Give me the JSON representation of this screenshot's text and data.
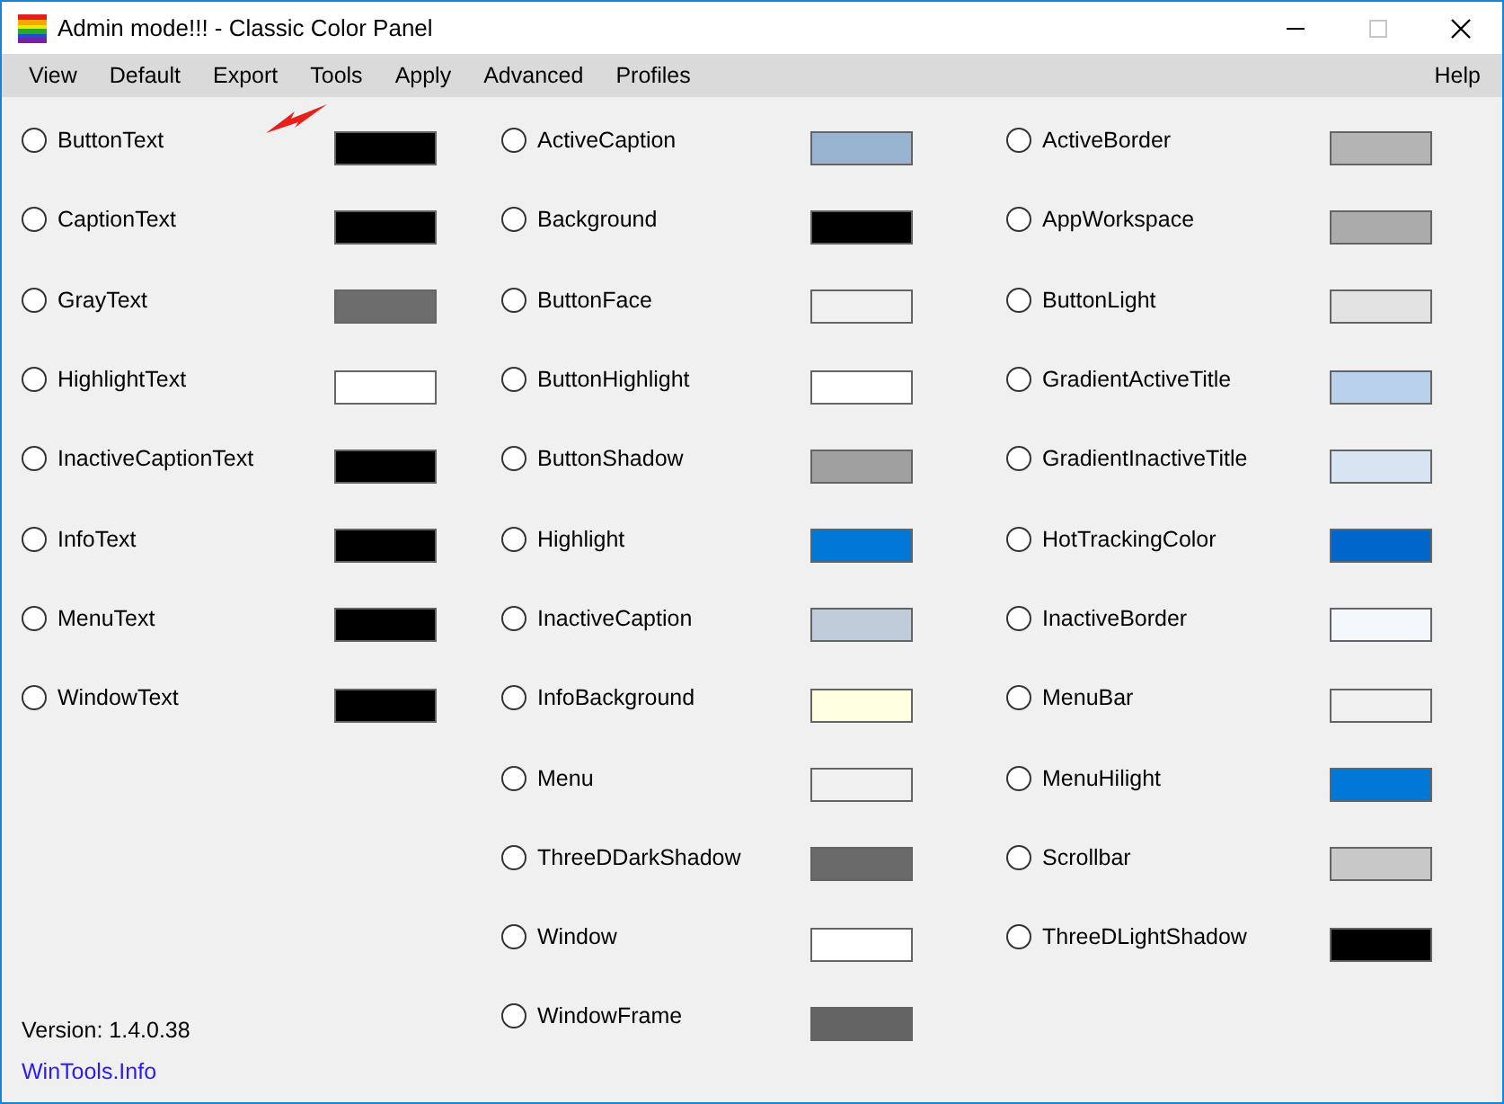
{
  "window": {
    "title": "Admin mode!!! - Classic Color Panel"
  },
  "menu": [
    {
      "label": "View"
    },
    {
      "label": "Default"
    },
    {
      "label": "Export"
    },
    {
      "label": "Tools"
    },
    {
      "label": "Apply"
    },
    {
      "label": "Advanced"
    },
    {
      "label": "Profiles"
    }
  ],
  "help_menu": {
    "label": "Help"
  },
  "columns": [
    [
      {
        "name": "ButtonText",
        "color": "#000000",
        "selected": false
      },
      {
        "name": "CaptionText",
        "color": "#000000",
        "selected": false
      },
      {
        "name": "GrayText",
        "color": "#6d6d6d",
        "selected": false
      },
      {
        "name": "HighlightText",
        "color": "#ffffff",
        "selected": false
      },
      {
        "name": "InactiveCaptionText",
        "color": "#000000",
        "selected": false
      },
      {
        "name": "InfoText",
        "color": "#000000",
        "selected": false
      },
      {
        "name": "MenuText",
        "color": "#000000",
        "selected": false
      },
      {
        "name": "WindowText",
        "color": "#000000",
        "selected": false
      }
    ],
    [
      {
        "name": "ActiveCaption",
        "color": "#99b4d1",
        "selected": false
      },
      {
        "name": "Background",
        "color": "#000000",
        "selected": false
      },
      {
        "name": "ButtonFace",
        "color": "#f0f0f0",
        "selected": false
      },
      {
        "name": "ButtonHighlight",
        "color": "#ffffff",
        "selected": false
      },
      {
        "name": "ButtonShadow",
        "color": "#a0a0a0",
        "selected": false
      },
      {
        "name": "Highlight",
        "color": "#0078d7",
        "selected": false
      },
      {
        "name": "InactiveCaption",
        "color": "#bfcddb",
        "selected": false
      },
      {
        "name": "InfoBackground",
        "color": "#ffffe1",
        "selected": false
      },
      {
        "name": "Menu",
        "color": "#f0f0f0",
        "selected": false
      },
      {
        "name": "ThreeDDarkShadow",
        "color": "#696969",
        "selected": false
      },
      {
        "name": "Window",
        "color": "#ffffff",
        "selected": false
      },
      {
        "name": "WindowFrame",
        "color": "#646464",
        "selected": false
      }
    ],
    [
      {
        "name": "ActiveBorder",
        "color": "#b4b4b4",
        "selected": false
      },
      {
        "name": "AppWorkspace",
        "color": "#ababab",
        "selected": false
      },
      {
        "name": "ButtonLight",
        "color": "#e3e3e3",
        "selected": false
      },
      {
        "name": "GradientActiveTitle",
        "color": "#b9d1ea",
        "selected": false
      },
      {
        "name": "GradientInactiveTitle",
        "color": "#d7e4f2",
        "selected": false
      },
      {
        "name": "HotTrackingColor",
        "color": "#0066cc",
        "selected": false
      },
      {
        "name": "InactiveBorder",
        "color": "#f4f7fc",
        "selected": false
      },
      {
        "name": "MenuBar",
        "color": "#f0f0f0",
        "selected": false
      },
      {
        "name": "MenuHilight",
        "color": "#0078d7",
        "selected": false
      },
      {
        "name": "Scrollbar",
        "color": "#c8c8c8",
        "selected": false
      },
      {
        "name": "ThreeDLightShadow",
        "color": "#000000",
        "selected": false
      }
    ]
  ],
  "version": "Version: 1.4.0.38",
  "link": "WinTools.Info"
}
